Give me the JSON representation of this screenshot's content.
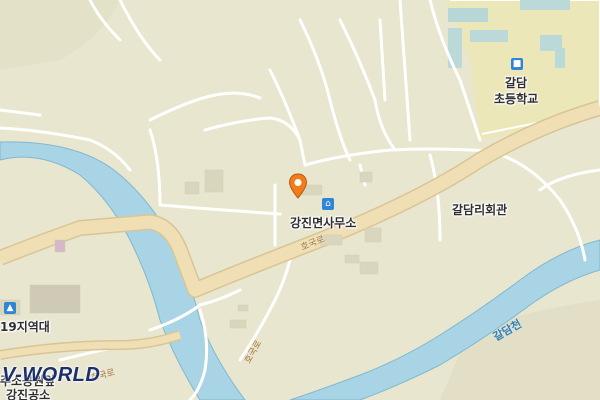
{
  "map": {
    "provider_logo": "V-WORLD",
    "labels": {
      "school_line1": "갈담",
      "school_line2": "초등학교",
      "office": "강진면사무소",
      "hall": "갈담리회관",
      "station": "19지역대",
      "road_main": "호국로",
      "road_south": "호국로",
      "road_sw": "호국로",
      "river": "갈담천",
      "bottom_left_1": "주소공원앞",
      "bottom_left_2": "강진공소"
    },
    "colors": {
      "background": "#e8e6cf",
      "road_fill": "#f0dfb5",
      "road_edge": "#d9c594",
      "minor_road": "#ffffff",
      "water": "#a8d4e6",
      "water_edge": "#7fb8cf",
      "marker": "#f07d1a",
      "poi_icon": "#2f86d6"
    },
    "icons": {
      "marker": "map-pin-icon",
      "office": "building-icon",
      "school": "school-icon",
      "station": "fire-station-icon"
    }
  }
}
